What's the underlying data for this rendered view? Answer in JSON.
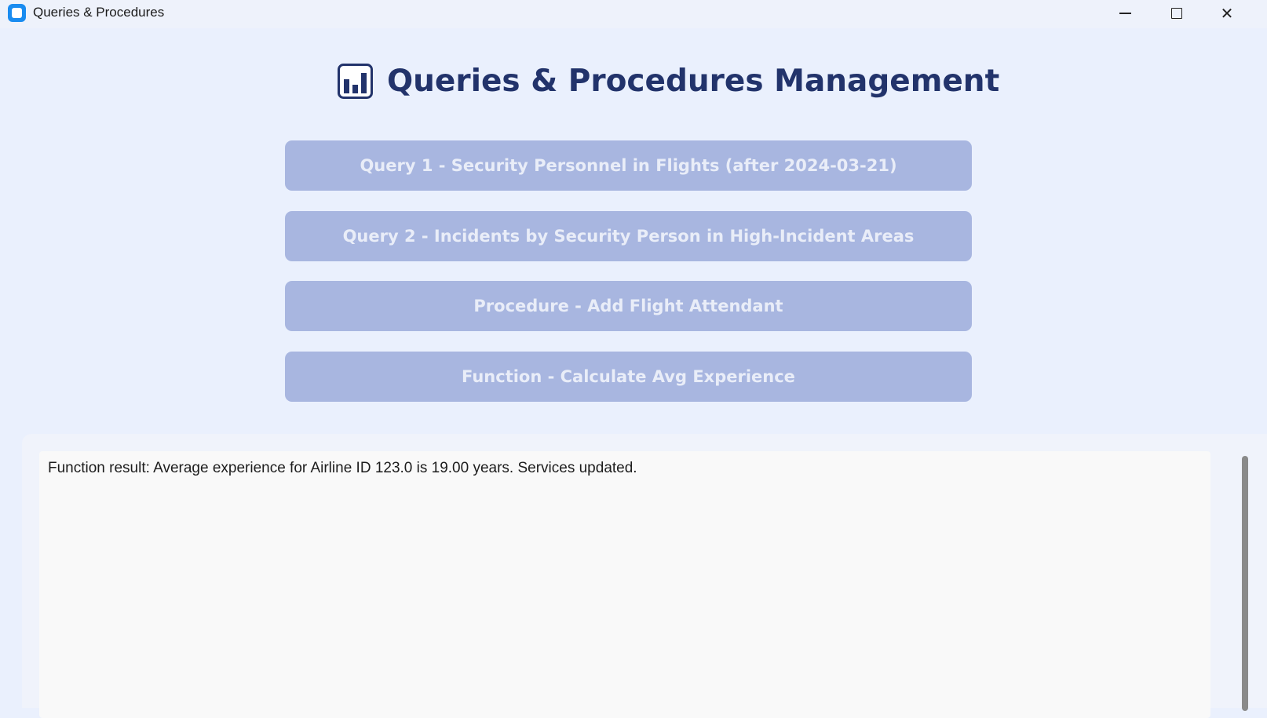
{
  "window": {
    "title": "Queries & Procedures",
    "icon": "app-icon",
    "controls": {
      "minimize_icon": "minimize-icon",
      "maximize_icon": "maximize-icon",
      "close_icon": "close-icon",
      "close_glyph": "✕"
    }
  },
  "header": {
    "icon": "bar-chart-icon",
    "title": "Queries & Procedures Management"
  },
  "actions": [
    {
      "label": "Query 1 - Security Personnel in Flights (after 2024-03-21)"
    },
    {
      "label": "Query 2 - Incidents by Security Person in High-Incident Areas"
    },
    {
      "label": "Procedure - Add Flight Attendant"
    },
    {
      "label": "Function - Calculate Avg Experience"
    }
  ],
  "output": {
    "text": "Function result: Average experience for Airline ID 123.0 is 19.00 years. Services updated."
  },
  "colors": {
    "background": "#eaf0fd",
    "title": "#22336b",
    "button_bg": "#a8b6e0",
    "button_text": "#e9edf8",
    "app_icon": "#1a8cf0"
  }
}
